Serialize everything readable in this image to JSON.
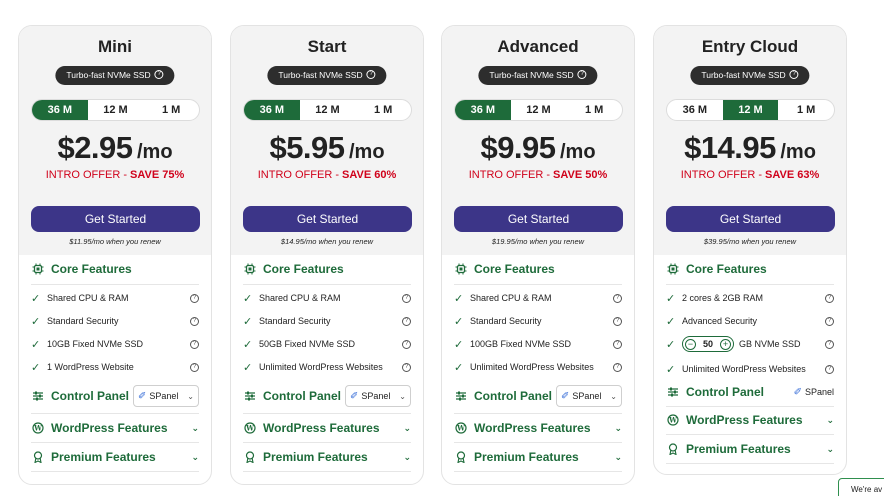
{
  "badge_text": "Turbo-fast NVMe SSD",
  "terms": [
    "36 M",
    "12 M",
    "1 M"
  ],
  "sections": {
    "core": "Core Features",
    "control_panel": "Control Panel",
    "wordpress": "WordPress Features",
    "premium": "Premium Features"
  },
  "cta_label": "Get Started",
  "per_month": "/mo",
  "intro_prefix": "INTRO OFFER - ",
  "panel_name": "SPanel",
  "plans": [
    {
      "name": "Mini",
      "active_term": "36 M",
      "price": "$2.95",
      "save": "SAVE 75%",
      "renew": "$11.95/mo when you renew",
      "features": [
        "Shared CPU & RAM",
        "Standard Security",
        "10GB Fixed NVMe SSD",
        "1 WordPress Website"
      ]
    },
    {
      "name": "Start",
      "active_term": "36 M",
      "price": "$5.95",
      "save": "SAVE 60%",
      "renew": "$14.95/mo when you renew",
      "features": [
        "Shared CPU & RAM",
        "Standard Security",
        "50GB Fixed NVMe SSD",
        "Unlimited WordPress Websites"
      ]
    },
    {
      "name": "Advanced",
      "active_term": "36 M",
      "price": "$9.95",
      "save": "SAVE 50%",
      "renew": "$19.95/mo when you renew",
      "features": [
        "Shared CPU & RAM",
        "Standard Security",
        "100GB Fixed NVMe SSD",
        "Unlimited WordPress Websites"
      ]
    },
    {
      "name": "Entry Cloud",
      "active_term": "12 M",
      "price": "$14.95",
      "save": "SAVE 63%",
      "renew": "$39.95/mo when you renew",
      "features": [
        "2 cores & 2GB RAM",
        "Advanced Security",
        "GB NVMe SSD",
        "Unlimited WordPress Websites"
      ],
      "ssd_stepper_value": "50"
    }
  ],
  "chat_label": "We're av",
  "colors": {
    "accent_green": "#1e6b3a",
    "cta_purple": "#3c3588",
    "intro_red": "#d0021b",
    "badge_dark": "#2d2d2d"
  },
  "icons": {
    "core": "chip-icon",
    "control_panel": "sliders-icon",
    "wordpress": "wordpress-icon",
    "premium": "award-icon",
    "feature": "check-icon",
    "help": "question-circle-icon"
  }
}
